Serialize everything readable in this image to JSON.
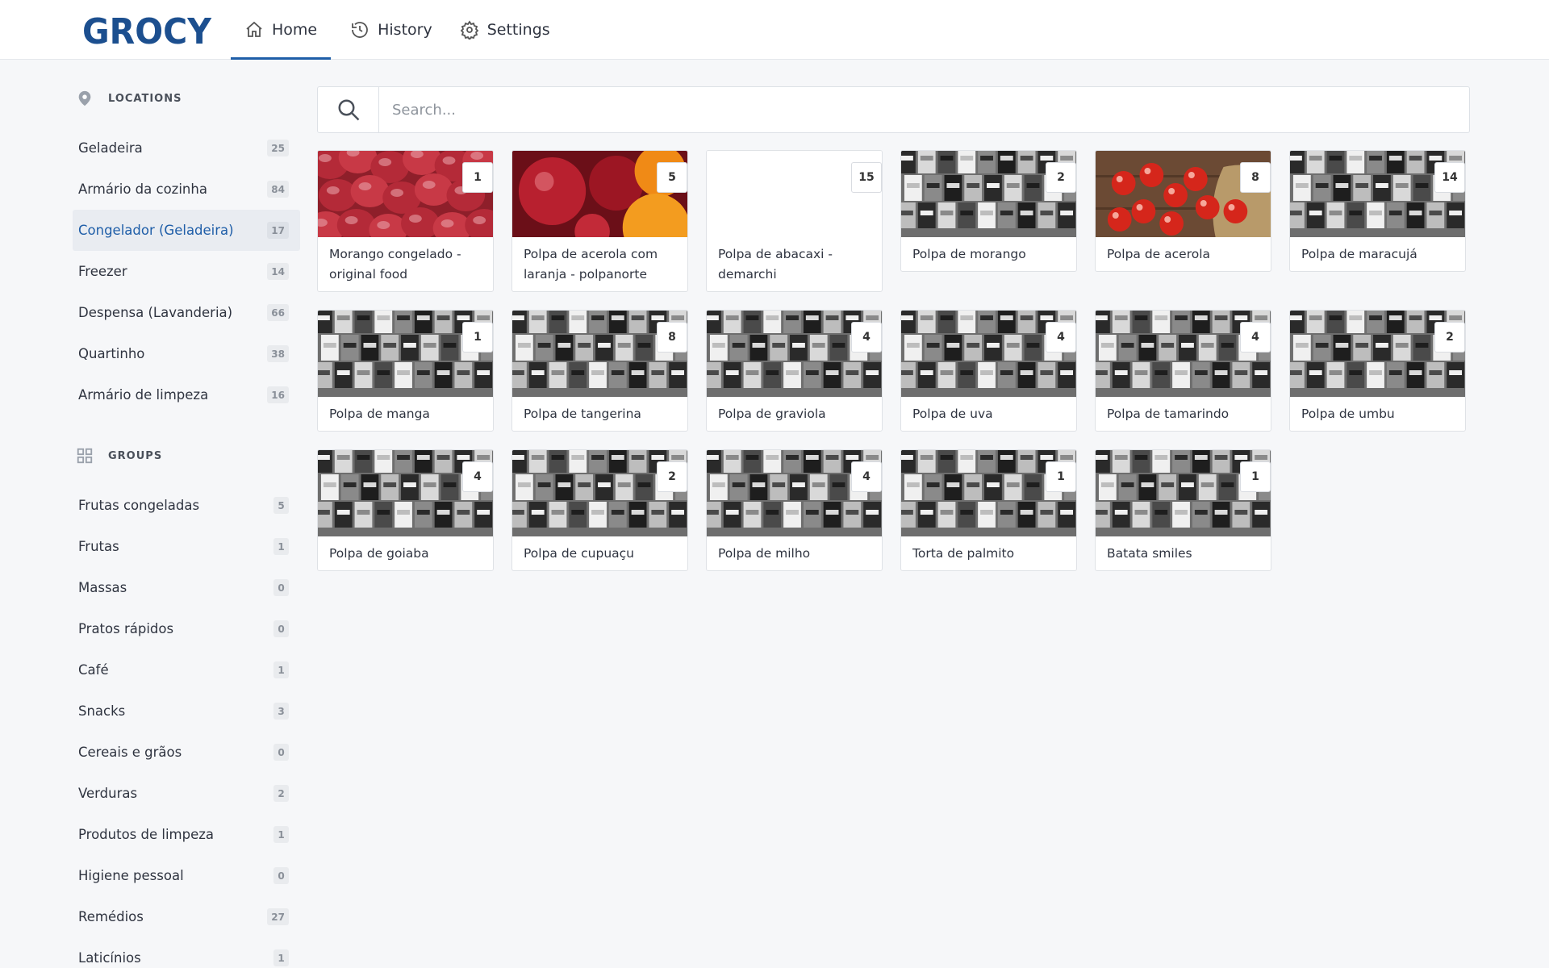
{
  "app": {
    "logo_text": "GROCY"
  },
  "nav": [
    {
      "label": "Home",
      "icon": "home-icon",
      "active": true
    },
    {
      "label": "History",
      "icon": "history-icon",
      "active": false
    },
    {
      "label": "Settings",
      "icon": "gear-icon",
      "active": false
    }
  ],
  "sidebar": {
    "locations_heading": "LOCATIONS",
    "locations": [
      {
        "label": "Geladeira",
        "count": "25"
      },
      {
        "label": "Armário da cozinha",
        "count": "84"
      },
      {
        "label": "Congelador (Geladeira)",
        "count": "17",
        "active": true
      },
      {
        "label": "Freezer",
        "count": "14"
      },
      {
        "label": "Despensa (Lavanderia)",
        "count": "66"
      },
      {
        "label": "Quartinho",
        "count": "38"
      },
      {
        "label": "Armário de limpeza",
        "count": "16"
      }
    ],
    "groups_heading": "GROUPS",
    "groups": [
      {
        "label": "Frutas congeladas",
        "count": "5"
      },
      {
        "label": "Frutas",
        "count": "1"
      },
      {
        "label": "Massas",
        "count": "0"
      },
      {
        "label": "Pratos rápidos",
        "count": "0"
      },
      {
        "label": "Café",
        "count": "1"
      },
      {
        "label": "Snacks",
        "count": "3"
      },
      {
        "label": "Cereais e grãos",
        "count": "0"
      },
      {
        "label": "Verduras",
        "count": "2"
      },
      {
        "label": "Produtos de limpeza",
        "count": "1"
      },
      {
        "label": "Higiene pessoal",
        "count": "0"
      },
      {
        "label": "Remédios",
        "count": "27"
      },
      {
        "label": "Laticínios",
        "count": "1"
      }
    ]
  },
  "search": {
    "placeholder": "Search..."
  },
  "products": [
    {
      "name": "Morango congelado - original food",
      "qty": "1",
      "image": "strawberries"
    },
    {
      "name": "Polpa de acerola com laranja - polpanorte",
      "qty": "5",
      "image": "acerola-orange"
    },
    {
      "name": "Polpa de abacaxi - demarchi",
      "qty": "15",
      "image": "none"
    },
    {
      "name": "Polpa de morango",
      "qty": "2",
      "image": "pantry"
    },
    {
      "name": "Polpa de acerola",
      "qty": "8",
      "image": "acerola"
    },
    {
      "name": "Polpa de maracujá",
      "qty": "14",
      "image": "pantry"
    },
    {
      "name": "Polpa de manga",
      "qty": "1",
      "image": "pantry"
    },
    {
      "name": "Polpa de tangerina",
      "qty": "8",
      "image": "pantry"
    },
    {
      "name": "Polpa de graviola",
      "qty": "4",
      "image": "pantry"
    },
    {
      "name": "Polpa de uva",
      "qty": "4",
      "image": "pantry"
    },
    {
      "name": "Polpa de tamarindo",
      "qty": "4",
      "image": "pantry"
    },
    {
      "name": "Polpa de umbu",
      "qty": "2",
      "image": "pantry"
    },
    {
      "name": "Polpa de goiaba",
      "qty": "4",
      "image": "pantry"
    },
    {
      "name": "Polpa de cupuaçu",
      "qty": "2",
      "image": "pantry"
    },
    {
      "name": "Polpa de milho",
      "qty": "4",
      "image": "pantry"
    },
    {
      "name": "Torta de palmito",
      "qty": "1",
      "image": "pantry"
    },
    {
      "name": "Batata smiles",
      "qty": "1",
      "image": "pantry"
    }
  ],
  "colors": {
    "accent": "#1f5ea8",
    "logo": "#1c4f8f"
  }
}
